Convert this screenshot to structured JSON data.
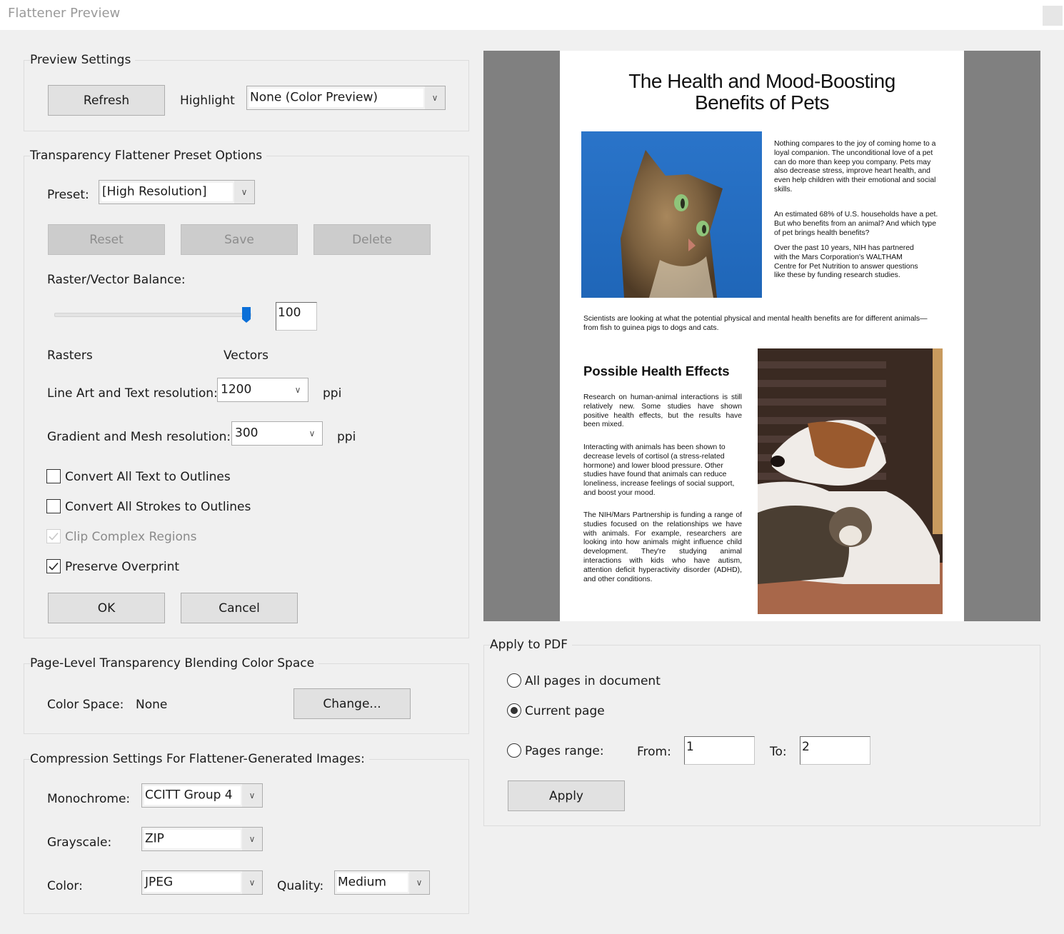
{
  "window": {
    "title": "Flattener Preview"
  },
  "preview_settings": {
    "legend": "Preview Settings",
    "refresh_label": "Refresh",
    "highlight_label": "Highlight",
    "highlight_value": "None (Color Preview)"
  },
  "preset_options": {
    "legend": "Transparency Flattener Preset Options",
    "preset_label": "Preset:",
    "preset_value": "[High Resolution]",
    "reset_label": "Reset",
    "save_label": "Save",
    "delete_label": "Delete",
    "balance_label": "Raster/Vector Balance:",
    "balance_value": "100",
    "balance_fraction": 1.0,
    "rasters_label": "Rasters",
    "vectors_label": "Vectors",
    "lineart_label": "Line Art and Text resolution:",
    "lineart_value": "1200",
    "gradient_label": "Gradient and Mesh resolution:",
    "gradient_value": "300",
    "ppi_label": "ppi",
    "checkboxes": [
      {
        "label": "Convert All Text to Outlines",
        "checked": false,
        "disabled": false
      },
      {
        "label": "Convert All Strokes to Outlines",
        "checked": false,
        "disabled": false
      },
      {
        "label": "Clip Complex Regions",
        "checked": true,
        "disabled": true
      },
      {
        "label": "Preserve Overprint",
        "checked": true,
        "disabled": false
      }
    ],
    "ok_label": "OK",
    "cancel_label": "Cancel"
  },
  "color_space": {
    "legend": "Page-Level Transparency Blending Color Space",
    "label": "Color Space:",
    "value": "None",
    "change_label": "Change..."
  },
  "compression": {
    "legend": "Compression Settings For Flattener-Generated Images:",
    "monochrome_label": "Monochrome:",
    "monochrome_value": "CCITT Group 4",
    "grayscale_label": "Grayscale:",
    "grayscale_value": "ZIP",
    "color_label": "Color:",
    "color_value": "JPEG",
    "quality_label": "Quality:",
    "quality_value": "Medium"
  },
  "apply_to_pdf": {
    "legend": "Apply to PDF",
    "options": [
      {
        "label": "All pages in document",
        "selected": false
      },
      {
        "label": "Current page",
        "selected": true
      },
      {
        "label": "Pages range:",
        "selected": false
      }
    ],
    "from_label": "From:",
    "from_value": "1",
    "to_label": "To:",
    "to_value": "2",
    "apply_label": "Apply"
  },
  "preview_page": {
    "title_line1": "The Health and Mood-Boosting",
    "title_line2": "Benefits of Pets",
    "intro_p1": "Nothing compares to the joy of coming home to a loyal companion. The unconditional love of a pet can do more than keep you company. Pets may also decrease stress, improve heart health, and even help children with their emotional and social skills.",
    "intro_p2": "An estimated 68% of U.S. households have a pet. But who benefits from an animal? And which type of pet brings health benefits?",
    "intro_p3": "Over the past 10 years, NIH has partnered with the Mars Corporation's WALTHAM Centre for Pet Nutrition to answer questions like these by funding research studies.",
    "wide_p": "Scientists are looking at what the potential physical and mental health benefits are for different animals—from fish to guinea pigs to dogs and cats.",
    "section_heading": "Possible Health Effects",
    "section_p1": "Research on human-animal interactions is still relatively new. Some studies have shown positive health effects, but the results have been mixed.",
    "section_p2": "Interacting with animals has been shown to decrease levels of cortisol (a stress-related hormone) and lower blood pressure. Other studies have found that animals can reduce loneliness, increase feelings of social support, and boost your mood.",
    "section_p3": "The NIH/Mars Partnership is funding a range of studies focused on the relationships we have with animals. For example, researchers are looking into how animals might influence child development. They're studying animal interactions with kids who have autism, attention deficit hyperactivity disorder (ADHD), and other conditions."
  },
  "colors": {
    "slider_accent": "#0a6fd8",
    "preview_bg": "#808080"
  }
}
